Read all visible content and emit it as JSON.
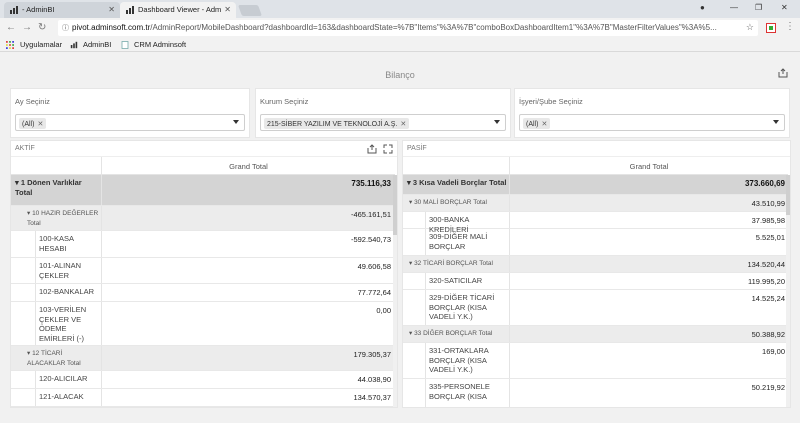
{
  "browser": {
    "tabs": [
      {
        "label": "- AdminBI"
      },
      {
        "label": "Dashboard Viewer - Adm"
      }
    ],
    "url_domain": "pivot.adminsoft.com.tr",
    "url_path": "/AdminReport/MobileDashboard?dashboardId=163&dashboardState=%7B\"Items\"%3A%7B\"comboBoxDashboardItem1\"%3A%7B\"MasterFilterValues\"%3A%5...",
    "bookmarks": [
      "Uygulamalar",
      "AdminBI",
      "CRM Adminsoft"
    ]
  },
  "dashboard": {
    "title": "Bilanço",
    "filters": [
      {
        "label": "Ay Seçiniz",
        "value": "(All)"
      },
      {
        "label": "Kurum Seçiniz",
        "value": "215-SİBER YAZILIM VE TEKNOLOJİ A.Ş."
      },
      {
        "label": "İşyeri/Şube Seçiniz",
        "value": "(All)"
      }
    ],
    "aktif": {
      "title": "AKTİF",
      "column_header": "Grand Total",
      "rows": [
        {
          "label": "▾ 1 Dönen Varlıklar Total",
          "value": "735.116,33"
        },
        {
          "label": "▾ 10 HAZIR DEĞERLER Total",
          "value": "-465.161,51"
        },
        {
          "label": "100-KASA HESABI",
          "value": "-592.540,73"
        },
        {
          "label": "101-ALINAN ÇEKLER",
          "value": "49.606,58"
        },
        {
          "label": "102-BANKALAR",
          "value": "77.772,64"
        },
        {
          "label": "103-VERİLEN ÇEKLER VE ÖDEME EMİRLERİ (-)",
          "value": "0,00"
        },
        {
          "label": "▾ 12 TİCARİ ALACAKLAR Total",
          "value": "179.305,37"
        },
        {
          "label": "120-ALICILAR",
          "value": "44.038,90"
        },
        {
          "label": "121-ALACAK",
          "value": "134.570,37"
        }
      ]
    },
    "pasif": {
      "title": "PASİF",
      "column_header": "Grand Total",
      "rows": [
        {
          "label": "▾ 3 Kısa Vadeli Borçlar Total",
          "value": "373.660,69"
        },
        {
          "label": "▾ 30 MALİ BORÇLAR Total",
          "value": "43.510,99"
        },
        {
          "label": "300-BANKA KREDİLERİ",
          "value": "37.985,98"
        },
        {
          "label": "309-DİĞER MALİ BORÇLAR",
          "value": "5.525,01"
        },
        {
          "label": "▾ 32 TİCARİ BORÇLAR Total",
          "value": "134.520,44"
        },
        {
          "label": "320-SATICILAR",
          "value": "119.995,20"
        },
        {
          "label": "329-DİĞER TİCARİ BORÇLAR (KISA VADELİ Y.K.)",
          "value": "14.525,24"
        },
        {
          "label": "▾ 33 DİĞER BORÇLAR Total",
          "value": "50.388,92"
        },
        {
          "label": "331-ORTAKLARA BORÇLAR (KISA VADELİ Y.K.)",
          "value": "169,00"
        },
        {
          "label": "335-PERSONELE BORÇLAR (KISA",
          "value": "50.219,92"
        }
      ]
    }
  }
}
